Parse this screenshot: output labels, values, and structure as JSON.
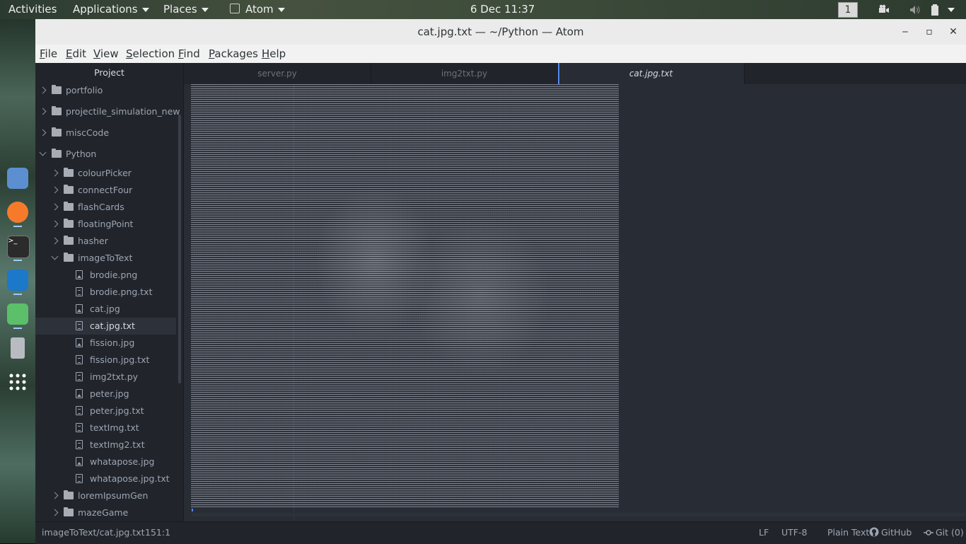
{
  "topbar": {
    "activities": "Activities",
    "applications": "Applications",
    "places": "Places",
    "app_name": "Atom",
    "clock": "6 Dec  11:37",
    "workspace": "1"
  },
  "window": {
    "title": "cat.jpg.txt — ~/Python — Atom",
    "controls": {
      "minimize": "‒",
      "maximize": "▫",
      "close": "✕"
    }
  },
  "menubar": {
    "items": [
      {
        "first": "F",
        "rest": "ile"
      },
      {
        "first": "E",
        "rest": "dit"
      },
      {
        "first": "V",
        "rest": "iew"
      },
      {
        "first": "S",
        "rest": "election"
      },
      {
        "first": "F",
        "rest": "ind"
      },
      {
        "first": "P",
        "rest": "ackages"
      },
      {
        "first": "H",
        "rest": "elp"
      }
    ]
  },
  "tree": {
    "header": "Project",
    "rows": [
      {
        "label": "portfolio",
        "type": "folder",
        "state": "closed"
      },
      {
        "label": "projectile_simulation_new",
        "type": "folder",
        "state": "closed"
      },
      {
        "label": "miscCode",
        "type": "folder",
        "state": "closed"
      },
      {
        "label": "Python",
        "type": "folder",
        "state": "open"
      },
      {
        "label": "colourPicker",
        "type": "folder",
        "state": "closed"
      },
      {
        "label": "connectFour",
        "type": "folder",
        "state": "closed"
      },
      {
        "label": "flashCards",
        "type": "folder",
        "state": "closed"
      },
      {
        "label": "floatingPoint",
        "type": "folder",
        "state": "closed"
      },
      {
        "label": "hasher",
        "type": "folder",
        "state": "closed"
      },
      {
        "label": "imageToText",
        "type": "folder",
        "state": "open"
      },
      {
        "label": "brodie.png",
        "type": "img"
      },
      {
        "label": "brodie.png.txt",
        "type": "txt"
      },
      {
        "label": "cat.jpg",
        "type": "img"
      },
      {
        "label": "cat.jpg.txt",
        "type": "txt",
        "selected": true
      },
      {
        "label": "fission.jpg",
        "type": "img"
      },
      {
        "label": "fission.jpg.txt",
        "type": "txt"
      },
      {
        "label": "img2txt.py",
        "type": "txt"
      },
      {
        "label": "peter.jpg",
        "type": "img"
      },
      {
        "label": "peter.jpg.txt",
        "type": "txt"
      },
      {
        "label": "textImg.txt",
        "type": "txt"
      },
      {
        "label": "textImg2.txt",
        "type": "txt"
      },
      {
        "label": "whatapose.jpg",
        "type": "img"
      },
      {
        "label": "whatapose.jpg.txt",
        "type": "txt"
      },
      {
        "label": "loremIpsumGen",
        "type": "folder",
        "state": "closed"
      },
      {
        "label": "mazeGame",
        "type": "folder",
        "state": "closed"
      }
    ]
  },
  "tabs": [
    {
      "label": "server.py"
    },
    {
      "label": "img2txt.py"
    },
    {
      "label": "cat.jpg.txt",
      "active": true
    }
  ],
  "statusbar": {
    "path": "imageToText/cat.jpg.txt",
    "cursor": "151:1",
    "line_ending": "LF",
    "encoding": "UTF-8",
    "grammar": "Plain Text",
    "github": "GitHub",
    "git": "Git (0)"
  }
}
